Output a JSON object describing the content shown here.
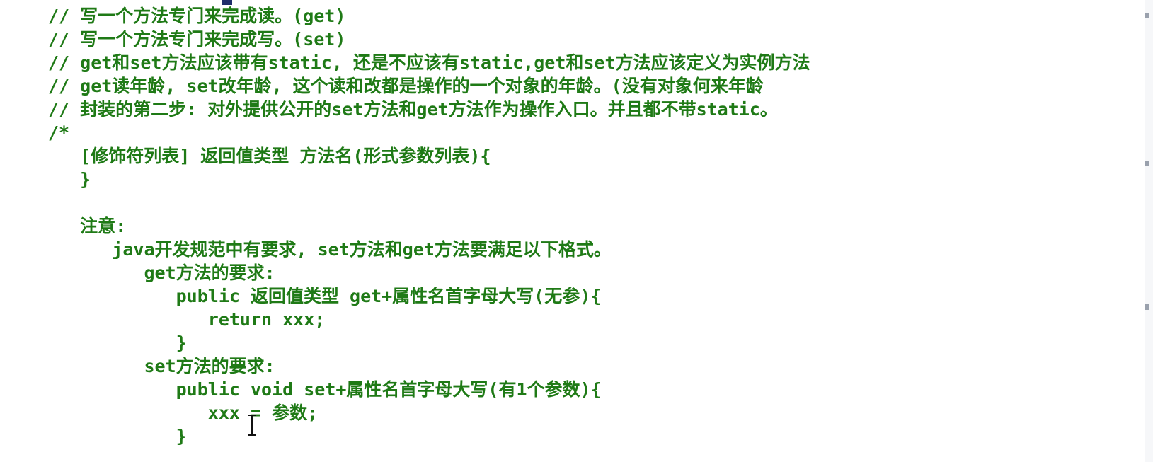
{
  "editor": {
    "lines": [
      "// 写一个方法专门来完成读。(get)",
      "// 写一个方法专门来完成写。(set)",
      "// get和set方法应该带有static, 还是不应该有static,get和set方法应该定义为实例方法",
      "// get读年龄, set改年龄, 这个读和改都是操作的一个对象的年龄。(没有对象何来年龄",
      "// 封装的第二步: 对外提供公开的set方法和get方法作为操作入口。并且都不带static。",
      "/*",
      "   [修饰符列表] 返回值类型 方法名(形式参数列表){",
      "   }",
      "",
      "   注意:",
      "      java开发规范中有要求, set方法和get方法要满足以下格式。",
      "         get方法的要求:",
      "            public 返回值类型 get+属性名首字母大写(无参){",
      "               return xxx;",
      "            }",
      "         set方法的要求:",
      "            public void set+属性名首字母大写(有1个参数){",
      "               xxx = 参数;",
      "            }"
    ]
  },
  "colors": {
    "comment": "#1f7a16",
    "background": "#ffffff"
  }
}
